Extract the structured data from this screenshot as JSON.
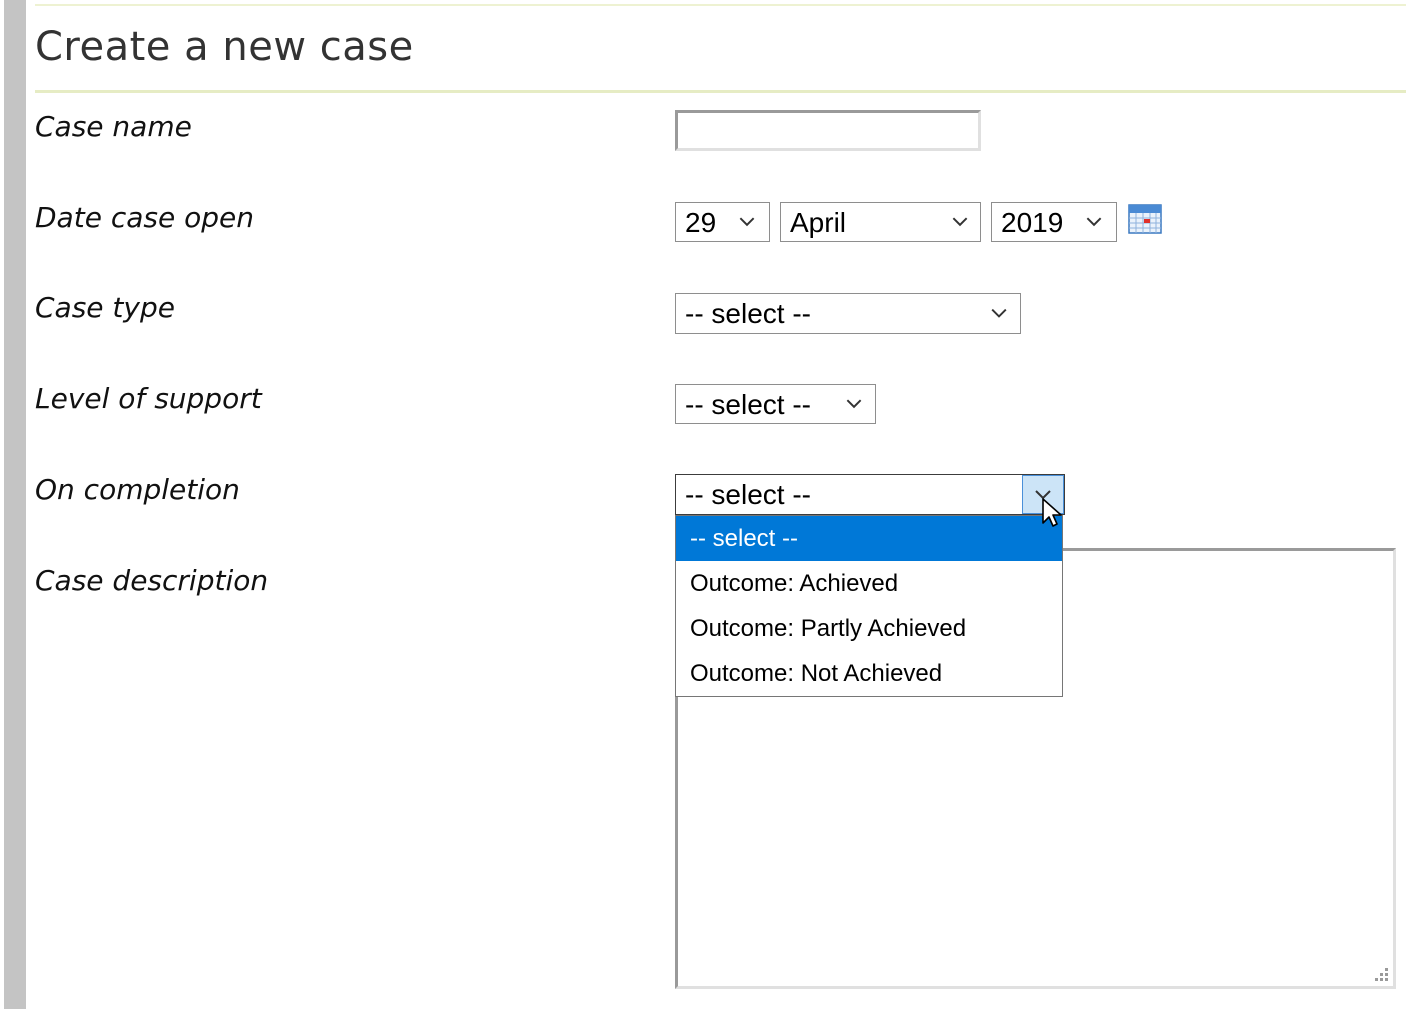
{
  "page": {
    "title": "Create a new case"
  },
  "form": {
    "case_name": {
      "label": "Case name",
      "value": ""
    },
    "date_open": {
      "label": "Date case open",
      "day": "29",
      "month": "April",
      "year": "2019",
      "calendar_icon": "calendar-icon"
    },
    "case_type": {
      "label": "Case type",
      "value": "-- select --"
    },
    "level_of_support": {
      "label": "Level of support",
      "value": "-- select --"
    },
    "on_completion": {
      "label": "On completion",
      "value": "-- select --",
      "options": [
        "-- select --",
        "Outcome: Achieved",
        "Outcome: Partly Achieved",
        "Outcome: Not Achieved"
      ],
      "highlighted_option": "-- select --"
    },
    "case_description": {
      "label": "Case description",
      "value": ""
    }
  },
  "colors": {
    "highlight": "#0078d7",
    "title_rule": "#e6ecc4",
    "side_bar": "#c4c4c4"
  },
  "icons": {
    "chevron": "chevron-down-icon",
    "cursor": "mouse-cursor-icon",
    "resize": "resize-grip-icon"
  }
}
